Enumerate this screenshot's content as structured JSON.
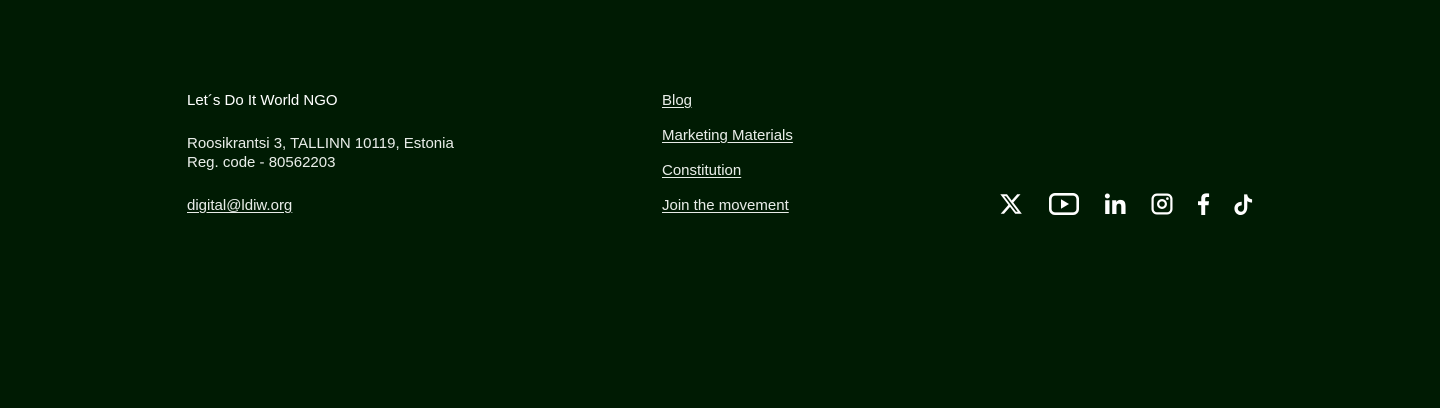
{
  "organization": {
    "name": "Let´s Do It World NGO",
    "address_line": "Roosikrantsi 3, TALLINN 10119, Estonia",
    "reg_code": "Reg. code - 80562203",
    "email": "digital@ldiw.org"
  },
  "links": [
    {
      "label": "Blog"
    },
    {
      "label": "Marketing Materials"
    },
    {
      "label": "Constitution"
    },
    {
      "label": "Join the movement"
    }
  ],
  "social": [
    {
      "icon": "x-twitter-icon"
    },
    {
      "icon": "youtube-icon"
    },
    {
      "icon": "linkedin-icon"
    },
    {
      "icon": "instagram-icon"
    },
    {
      "icon": "facebook-icon"
    },
    {
      "icon": "tiktok-icon"
    }
  ],
  "colors": {
    "background": "#001b03",
    "text": "#ffffff"
  }
}
